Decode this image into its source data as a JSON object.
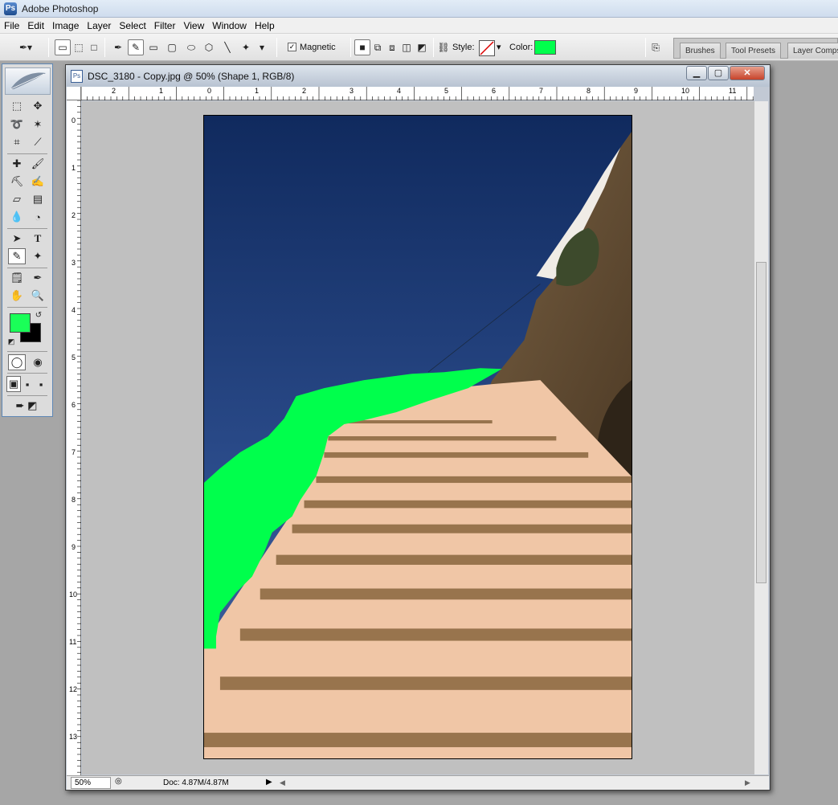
{
  "app": {
    "title": "Adobe Photoshop",
    "icon": "photoshop-app-icon"
  },
  "menubar": {
    "items": [
      "File",
      "Edit",
      "Image",
      "Layer",
      "Select",
      "Filter",
      "View",
      "Window",
      "Help"
    ]
  },
  "options_bar": {
    "magnetic_label": "Magnetic",
    "magnetic_checked": true,
    "style_label": "Style:",
    "color_label": "Color:",
    "shape_color": "#00ff4c"
  },
  "palette_well": {
    "tabs": [
      "Brushes",
      "Tool Presets",
      "Layer Comps"
    ]
  },
  "toolbox": {
    "foreground_color": "#1aff58",
    "background_color": "#000000"
  },
  "document": {
    "title": "DSC_3180 - Copy.jpg @ 50% (Shape 1, RGB/8)",
    "ruler_top": [
      "2",
      "1",
      "0",
      "1",
      "2",
      "3",
      "4",
      "5",
      "6",
      "7",
      "8",
      "9",
      "10",
      "11"
    ],
    "ruler_left": [
      "0",
      "1",
      "2",
      "3",
      "4",
      "5",
      "6",
      "7",
      "8",
      "9",
      "10",
      "11",
      "12",
      "13"
    ],
    "zoom": "50%",
    "doc_info": "Doc: 4.87M/4.87M",
    "sky_color": "#1f3f7e",
    "step_color": "#f0c6a6",
    "rock_color": "#6c5234"
  }
}
